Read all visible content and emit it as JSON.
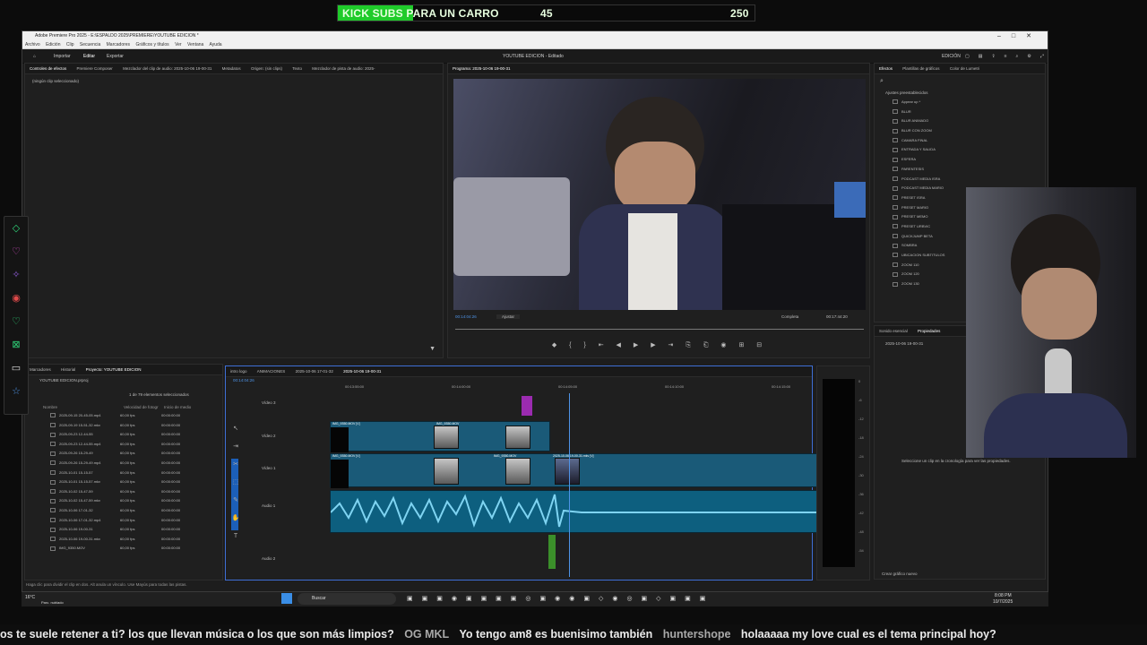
{
  "banner": {
    "text": "KICK SUBS PARA UN CARRO",
    "current": "45",
    "goal": "250",
    "progress": 0.18
  },
  "app": {
    "window_title": "Adobe Premiere Pro 2025 - E:\\ESPALDO 2025\\PREMIERE\\YOUTUBE EDICION *",
    "menus": [
      "Archivo",
      "Edición",
      "Clip",
      "Secuencia",
      "Marcadores",
      "Gráficos y títulos",
      "Ver",
      "Ventana",
      "Ayuda"
    ],
    "header_tabs": [
      "Importar",
      "Editar",
      "Exportar"
    ],
    "project_title": "YOUTUBE EDICION - Editado",
    "workspace": "EDICIÓN",
    "source_tabs": [
      "Controles de efectos",
      "Premiere Composer",
      "Mezclador del clip de audio: 2025-10-06 19-00-31",
      "Metadatos",
      "Origen: (sin clips)",
      "Texto",
      "Mezclador de pista de audio: 2025-"
    ],
    "source_empty": "(ningún clip seleccionado)",
    "program_label": "Programa: 2025-10-06 19-00-31",
    "program_timecode": "00:14:04:26",
    "fit_label": "Ajustar",
    "quality_label": "Completa",
    "duration": "00:17:44:20",
    "effects_tabs": [
      "Efectos",
      "Plantillas de gráficos",
      "Color de Lumetri"
    ],
    "presets_header": "Ajustes preestablecidos",
    "presets": [
      "Appear up *",
      "BLUR",
      "BLUR ANIMADO",
      "BLUR CON ZOOM",
      "CAMARA FINAL",
      "ENTRADA Y SALIDA",
      "ESFERA",
      "PARENTESIS",
      "PODCAST MEDIA ISRA",
      "PODCAST MEDIA MARIO",
      "PRESET ISRA",
      "PRESET MARIO",
      "PRESET MEMO",
      "PRESET URBVIC",
      "QUICKJUMP BETA",
      "SOMBRA",
      "UBICACION SUBTITULOS",
      "ZOOM 110",
      "ZOOM 120",
      "ZOOM 130"
    ],
    "props_tabs": [
      "Sonido esencial",
      "Propiedades"
    ],
    "props_clip": "2025-10-06 19-00-31",
    "props_hint": "Seleccione un clip en la cronología para ver las propiedades.",
    "props_new_graphic": "Crear gráfico nuevo",
    "project_tabs": [
      "Marcadores",
      "Historial",
      "Proyecto: YOUTUBE EDICION"
    ],
    "project_file": "YOUTUBE EDICION.prproj",
    "project_count": "1 de 79 elementos seleccionados",
    "project_columns": [
      "Nombre",
      "Velocidad de fotogr",
      "Inicio de medio"
    ],
    "project_items": [
      {
        "name": "2025-09-15 20-45-05.mp4",
        "fps": "60,00 fps",
        "start": "00:00:00:00"
      },
      {
        "name": "2025-09-19 15-51-32.mkv",
        "fps": "60,00 fps",
        "start": "00:00:00:00"
      },
      {
        "name": "2025-09-23 12-44-55",
        "fps": "60,00 fps",
        "start": "00:00:00:00"
      },
      {
        "name": "2025-09-23 12-44-55.mp4",
        "fps": "60,00 fps",
        "start": "00:00:00:00"
      },
      {
        "name": "2025-09-26 15-29-49",
        "fps": "60,00 fps",
        "start": "00:00:00:00"
      },
      {
        "name": "2025-09-26 15-29-49.mp4",
        "fps": "60,00 fps",
        "start": "00:00:00:00"
      },
      {
        "name": "2025-10-01 15-15-57",
        "fps": "60,00 fps",
        "start": "00:00:00:00"
      },
      {
        "name": "2025-10-01 15-15-57.mkv",
        "fps": "60,00 fps",
        "start": "00:00:00:00"
      },
      {
        "name": "2025-10-02 15-47-59",
        "fps": "60,00 fps",
        "start": "00:00:00:00"
      },
      {
        "name": "2025-10-02 15-47-59.mkv",
        "fps": "60,00 fps",
        "start": "00:00:00:00"
      },
      {
        "name": "2025-10-06 17-01-32",
        "fps": "60,00 fps",
        "start": "00:00:00:00"
      },
      {
        "name": "2025-10-06 17-01-32.mp4",
        "fps": "60,00 fps",
        "start": "00:00:00:00"
      },
      {
        "name": "2025-10-06 19-00-31",
        "fps": "60,00 fps",
        "start": "00:00:00:00"
      },
      {
        "name": "2025-10-06 19-00-31.mkv",
        "fps": "60,00 fps",
        "start": "00:00:00:00"
      },
      {
        "name": "IMG_9350.MOV",
        "fps": "60,00 fps",
        "start": "00:00:00:00"
      }
    ],
    "seq_tabs": [
      "intro logo",
      "ANIMACIONES",
      "2025-10-06 17-01-32",
      "2025-10-06 19-00-31"
    ],
    "seq_timecode": "00:14:04:26",
    "ruler": [
      "00:13:55:00",
      "00:14:00:00",
      "00:14:05:00",
      "00:14:10:00",
      "00:14:15:00"
    ],
    "tracks": [
      "Vídeo 3",
      "Vídeo 2",
      "Vídeo 1",
      "Audio 1",
      "Audio 2"
    ],
    "track_ids": [
      "V3",
      "V2",
      "V1",
      "A1",
      "A2"
    ],
    "clip_labels": [
      "IMG_9350.MOV [V]",
      "IMG_9350.MOV",
      "IMG_9350.MOV [V]",
      "IMG_9350.MOV",
      "2025-10-06 19-00-31.mkv [V]"
    ],
    "vu_scale": [
      "0",
      "-6",
      "-12",
      "-18",
      "-24",
      "-30",
      "-36",
      "-42",
      "-48",
      "-54"
    ],
    "status": "Haga clic para dividir el clip en dos. Alt anula un vínculo. Use Mayús para todas las pistas."
  },
  "taskbar": {
    "weather": "16°C",
    "weather_sub": "Parc. nublado",
    "search": "Buscar",
    "time": "8:08 PM",
    "date": "10/7/2025"
  },
  "chat": [
    {
      "user": "",
      "msg": "os te suele retener a ti? los que llevan música o los que son más limpios?"
    },
    {
      "user": "OG MKL",
      "msg": "Yo tengo am8 es buenisimo también"
    },
    {
      "user": "huntershope",
      "msg": "holaaaaa my love  cual es el tema principal hoy?"
    }
  ]
}
